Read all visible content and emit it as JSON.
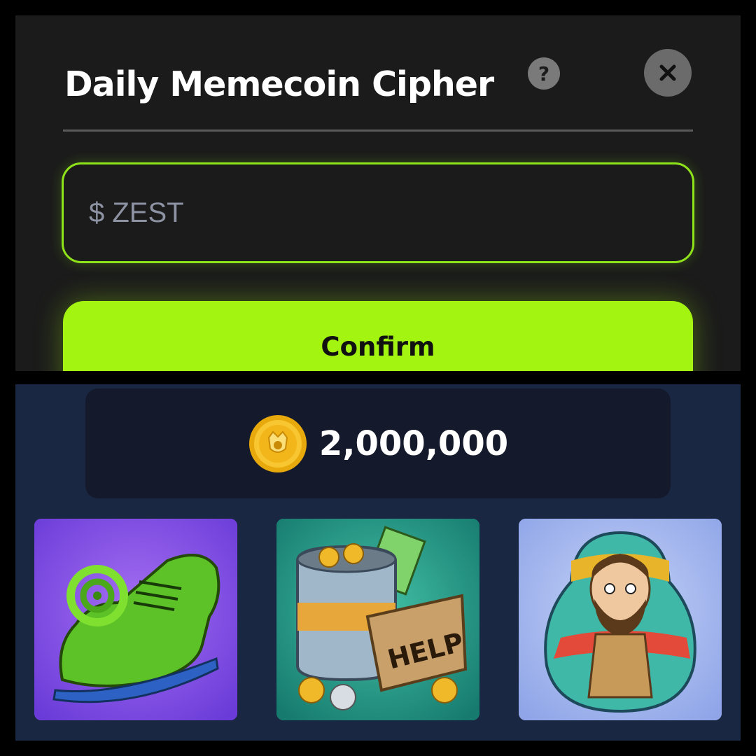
{
  "modal": {
    "title": "Daily Memecoin Cipher",
    "help_icon": "question-mark-icon",
    "close_icon": "close-icon",
    "input": {
      "value": "$ ZEST"
    },
    "confirm_label": "Confirm",
    "accent_color": "#a3f411"
  },
  "balance": {
    "coin_icon": "gold-coin-icon",
    "amount": "2,000,000"
  },
  "cards": [
    {
      "icon": "curled-green-shoe"
    },
    {
      "icon": "tin-can-with-coins-and-help-sign"
    },
    {
      "icon": "bearded-man-nesting-doll"
    }
  ],
  "card_texts": {
    "help_sign": "HELP"
  }
}
